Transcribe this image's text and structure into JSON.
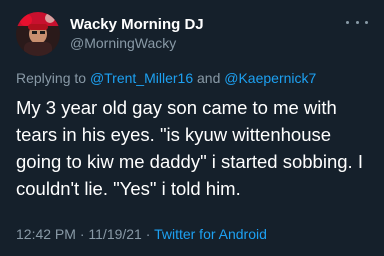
{
  "tweet": {
    "display_name": "Wacky Morning DJ",
    "handle": "@MorningWacky",
    "reply": {
      "prefix": "Replying to",
      "mention1": "@Trent_Miller16",
      "joiner": "and",
      "mention2": "@Kaepernick7"
    },
    "text": "My 3 year old gay son came to me with tears in his eyes. \"is kyuw wittenhouse going to kiw me daddy\" i started sobbing. I couldn't lie. \"Yes\" i told him.",
    "time": "12:42 PM",
    "separator1": "·",
    "date": "11/19/21",
    "separator2": "·",
    "source": "Twitter for Android"
  },
  "colors": {
    "background": "#15202b",
    "text": "#ffffff",
    "muted": "#8899a6",
    "link": "#1da1f2"
  },
  "icons": {
    "avatar": "avatar-image",
    "more": "more-options-icon"
  }
}
